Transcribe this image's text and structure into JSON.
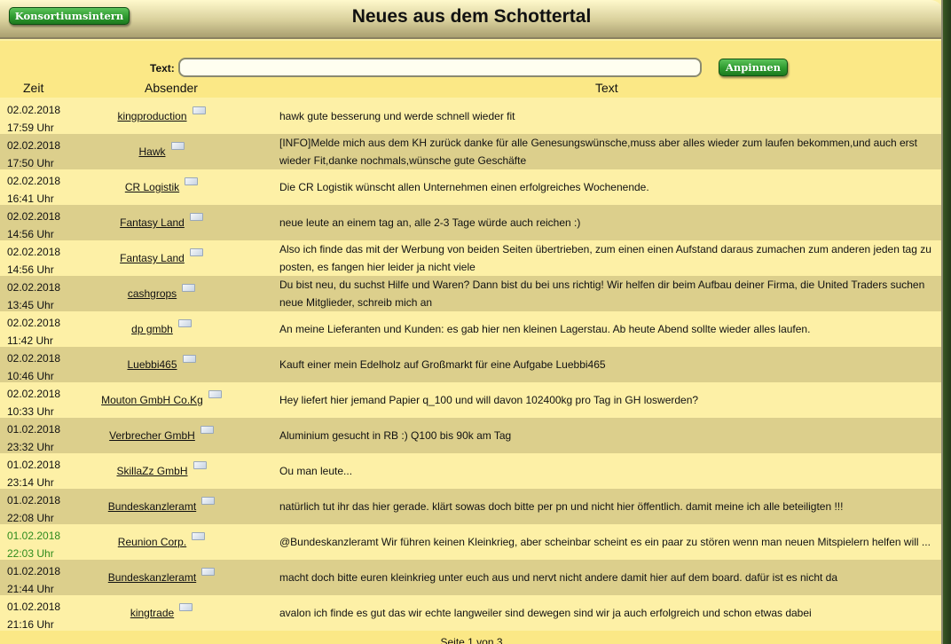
{
  "header": {
    "title": "Neues aus dem Schottertal",
    "konsortium_button": "Konsortiumsintern"
  },
  "form": {
    "text_label": "Text:",
    "text_value": "",
    "pin_button": "Anpinnen"
  },
  "columns": {
    "time": "Zeit",
    "sender": "Absender",
    "text": "Text"
  },
  "colors": {
    "green_time": "#2e8b1d",
    "odd_row": "#fdf0a6",
    "even_row": "#dccf8c"
  },
  "messages": [
    {
      "date": "02.02.2018",
      "time": "17:59 Uhr",
      "sender": "kingproduction",
      "text": "hawk gute besserung und werde schnell wieder fit"
    },
    {
      "date": "02.02.2018",
      "time": "17:50 Uhr",
      "sender": "Hawk",
      "text": "[INFO]Melde mich aus dem KH zurück danke für alle Genesungswünsche,muss aber alles wieder zum laufen bekommen,und auch erst wieder Fit,danke nochmals,wünsche gute Geschäfte"
    },
    {
      "date": "02.02.2018",
      "time": "16:41 Uhr",
      "sender": "CR Logistik",
      "text": "Die CR Logistik wünscht allen Unternehmen einen erfolgreiches Wochenende."
    },
    {
      "date": "02.02.2018",
      "time": "14:56 Uhr",
      "sender": "Fantasy Land",
      "text": "neue leute an einem tag an, alle 2-3 Tage würde auch reichen :)"
    },
    {
      "date": "02.02.2018",
      "time": "14:56 Uhr",
      "sender": "Fantasy Land",
      "text": "Also ich finde das mit der Werbung von beiden Seiten übertrieben, zum einen einen Aufstand daraus zumachen zum anderen jeden tag zu posten, es fangen hier leider ja nicht viele"
    },
    {
      "date": "02.02.2018",
      "time": "13:45 Uhr",
      "sender": "cashgrops",
      "text": "Du bist neu, du suchst Hilfe und Waren? Dann bist du bei uns richtig! Wir helfen dir beim Aufbau deiner Firma, die United Traders suchen neue Mitglieder, schreib mich an"
    },
    {
      "date": "02.02.2018",
      "time": "11:42 Uhr",
      "sender": "dp gmbh",
      "text": "An meine Lieferanten und Kunden: es gab hier nen kleinen Lagerstau. Ab heute Abend sollte wieder alles laufen."
    },
    {
      "date": "02.02.2018",
      "time": "10:46 Uhr",
      "sender": "Luebbi465",
      "text": "Kauft einer mein Edelholz auf Großmarkt für eine Aufgabe Luebbi465"
    },
    {
      "date": "02.02.2018",
      "time": "10:33 Uhr",
      "sender": "Mouton GmbH Co.Kg",
      "text": "Hey liefert hier jemand Papier q_100 und will davon 102400kg pro Tag in GH loswerden?"
    },
    {
      "date": "01.02.2018",
      "time": "23:32 Uhr",
      "sender": "Verbrecher GmbH",
      "text": "Aluminium gesucht in RB :) Q100 bis 90k am Tag"
    },
    {
      "date": "01.02.2018",
      "time": "23:14 Uhr",
      "sender": "SkillaZz GmbH",
      "text": "Ou man leute..."
    },
    {
      "date": "01.02.2018",
      "time": "22:08 Uhr",
      "sender": "Bundeskanzleramt",
      "text": "natürlich tut ihr das hier gerade. klärt sowas doch bitte per pn und nicht hier öffentlich. damit meine ich alle beteiligten !!!"
    },
    {
      "date": "01.02.2018",
      "time": "22:03 Uhr",
      "sender": "Reunion Corp.",
      "text": "@Bundeskanzleramt Wir führen keinen Kleinkrieg, aber scheinbar scheint es ein paar zu stören wenn man neuen Mitspielern helfen will ...",
      "highlight": true
    },
    {
      "date": "01.02.2018",
      "time": "21:44 Uhr",
      "sender": "Bundeskanzleramt",
      "text": "macht doch bitte euren kleinkrieg unter euch aus und nervt nicht andere damit hier auf dem board. dafür ist es nicht da"
    },
    {
      "date": "01.02.2018",
      "time": "21:16 Uhr",
      "sender": "kingtrade",
      "text": "avalon ich finde es gut das wir echte langweiler sind dewegen sind wir ja auch erfolgreich und schon etwas dabei"
    }
  ],
  "pager": {
    "label": "Seite 1 von 3"
  }
}
